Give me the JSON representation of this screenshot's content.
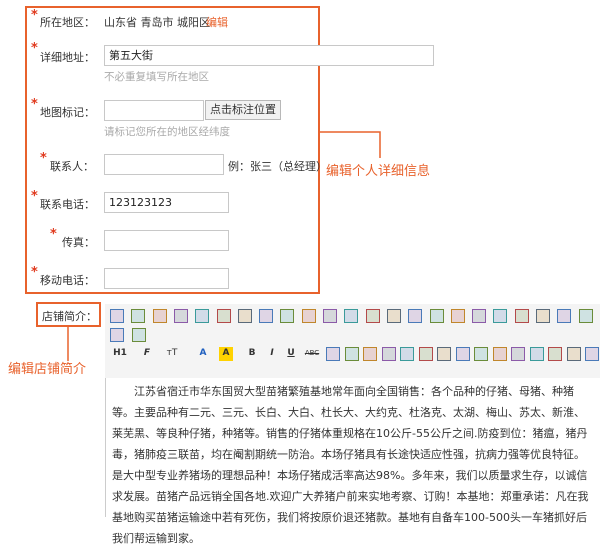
{
  "form": {
    "region": {
      "label": "所在地区：",
      "value": "山东省 青岛市 城阳区",
      "edit_link": "编辑"
    },
    "address": {
      "label": "详细地址：",
      "value": "第五大街",
      "hint": "不必重复填写所在地区"
    },
    "map": {
      "label": "地图标记：",
      "value": "",
      "button": "点击标注位置",
      "hint": "请标记您所在的地区经纬度"
    },
    "contact": {
      "label": "联系人：",
      "value": "",
      "example": "例：张三（总经理）"
    },
    "phone": {
      "label": "联系电话：",
      "value": "123123123"
    },
    "fax": {
      "label": "传真：",
      "value": ""
    },
    "mobile": {
      "label": "移动电话：",
      "value": ""
    },
    "shop_intro": {
      "label": "店铺简介："
    }
  },
  "annotations": {
    "personal": "编辑个人详细信息",
    "shop": "编辑店铺简介"
  },
  "toolbar": {
    "row1": [
      "source",
      "undo",
      "redo",
      "preview",
      "print",
      "template",
      "cut",
      "copy",
      "paste",
      "paste-text",
      "paste-word",
      "justify-left",
      "justify-center",
      "justify-right",
      "justify-full",
      "ordered-list",
      "unordered-list",
      "indent",
      "outdent",
      "subscript",
      "superscript",
      "clear-format",
      "select-all"
    ],
    "row2": [
      "select",
      "fullscreen"
    ],
    "row3_labels": {
      "heading": "H1",
      "font": "F",
      "size": "тT",
      "forecolor": "A",
      "backcolor": "A",
      "bold": "B",
      "italic": "I",
      "underline": "U",
      "strike": "ABC"
    },
    "row3": [
      "eraser",
      "image",
      "flash",
      "media",
      "table",
      "hr",
      "emoticon",
      "map",
      "anchor",
      "link",
      "unlink",
      "special-char",
      "pagebreak",
      "insert-file",
      "help"
    ]
  },
  "editor": {
    "content": "江苏省宿迁市华东国贸大型苗猪繁殖基地常年面向全国销售：各个品种的仔猪、母猪、种猪等。主要品种有二元、三元、长白、大白、杜长大、大约克、杜洛克、太湖、梅山、苏太、新淮、莱芜黑、等良种仔猪，种猪等。销售的仔猪体重规格在10公斤-55公斤之间.防疫到位：猪瘟，猪丹毒，猪肺疫三联苗，均在阉割期统一防治。本场仔猪具有长途快适应性强，抗病力强等优良特征。是大中型专业养猪场的理想品种！本场仔猪成活率高达98%。多年来，我们以质量求生存，以诚信求发展。苗猪产品远销全国各地.欢迎广大养猪户前来实地考察、订购！本基地：郑重承诺：凡在我基地购买苗猪运输途中若有死伤，我们将按原价退还猪款。基地有自备车100-500头一车猪抓好后我们帮运输到家。"
  },
  "colors": {
    "accent": "#e8622c",
    "required": "#e03a1e",
    "link": "#e8622c"
  }
}
